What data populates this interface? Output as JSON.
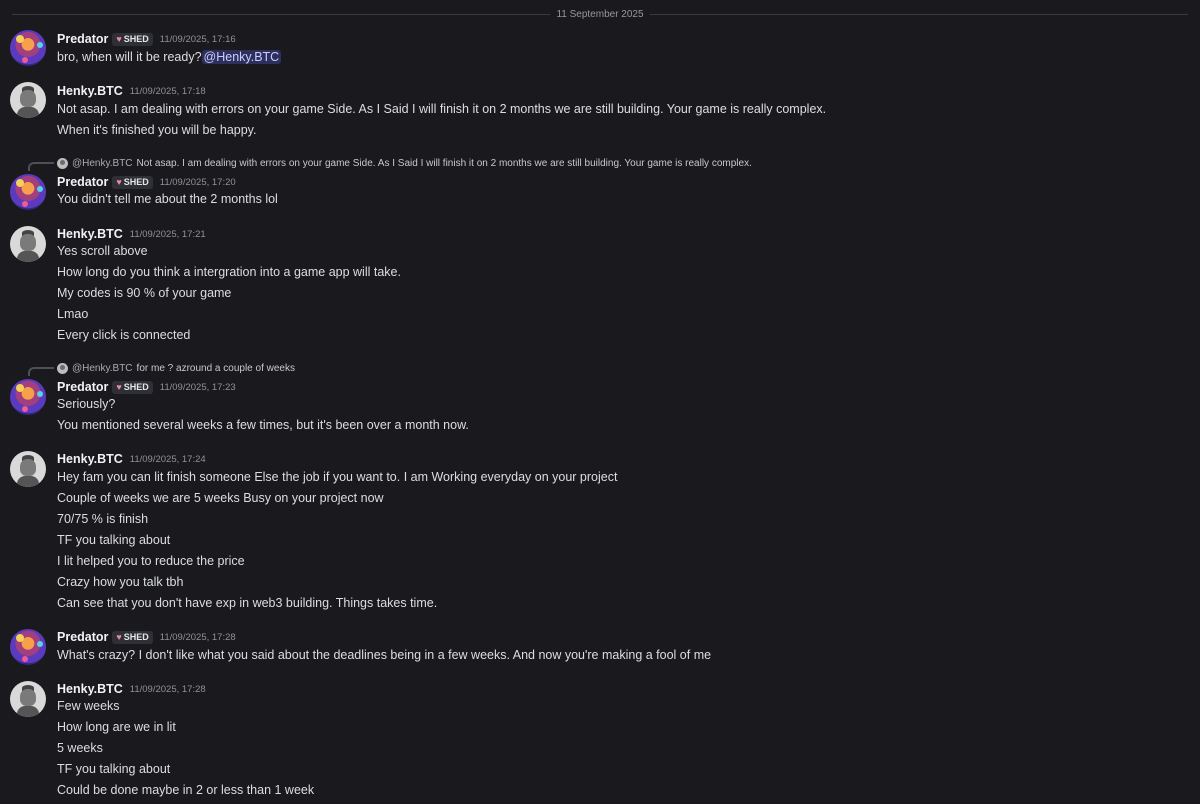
{
  "date_divider": "11 September 2025",
  "users": {
    "predator": {
      "name": "Predator",
      "tag": "SHED"
    },
    "henky": {
      "name": "Henky.BTC"
    }
  },
  "messages": [
    {
      "author": "Predator",
      "tag": "SHED",
      "time": "11/09/2025, 17:16",
      "lines": [
        "bro, when will it be ready?"
      ],
      "mention": "@Henky.BTC"
    },
    {
      "author": "Henky.BTC",
      "time": "11/09/2025, 17:18",
      "lines": [
        "Not asap. I am dealing with errors on your game Side. As I Said I will finish it on 2 months we are still building. Your game is really complex.",
        "When it's finished you will be happy."
      ]
    },
    {
      "reply": {
        "name": "@Henky.BTC",
        "text": "Not asap. I am dealing with errors on your game Side. As I Said I will finish it on 2 months we are still building. Your game is really complex."
      },
      "author": "Predator",
      "tag": "SHED",
      "time": "11/09/2025, 17:20",
      "lines": [
        "You didn't tell me about the 2 months lol"
      ]
    },
    {
      "author": "Henky.BTC",
      "time": "11/09/2025, 17:21",
      "lines": [
        "Yes scroll above",
        "How long do you think a intergration into a game app will take.",
        "My codes is 90 % of your game",
        "Lmao",
        "Every click is connected"
      ]
    },
    {
      "reply": {
        "name": "@Henky.BTC",
        "text": "for me ? azround a couple of weeks"
      },
      "author": "Predator",
      "tag": "SHED",
      "time": "11/09/2025, 17:23",
      "lines": [
        "Seriously?",
        "You mentioned several weeks a few times, but it's been over a month now."
      ]
    },
    {
      "author": "Henky.BTC",
      "time": "11/09/2025, 17:24",
      "lines": [
        "Hey fam you can lit finish someone Else the job if you want to. I am Working everyday on your project",
        "Couple of weeks we are 5 weeks Busy on your project now",
        "70/75 % is finish",
        "TF you talking about",
        "I lit helped you to reduce the price",
        "Crazy how you talk tbh",
        "Can see that you don't have exp in web3 building. Things takes time."
      ]
    },
    {
      "author": "Predator",
      "tag": "SHED",
      "time": "11/09/2025, 17:28",
      "lines": [
        "What's crazy? I don't like what you said about the deadlines being in a few weeks. And now you're making a fool of me"
      ]
    },
    {
      "author": "Henky.BTC",
      "time": "11/09/2025, 17:28",
      "lines": [
        "Few weeks",
        "How long are we in lit",
        "5 weeks",
        "TF you talking about",
        "Could be done maybe in 2 or less than 1 week"
      ]
    }
  ]
}
